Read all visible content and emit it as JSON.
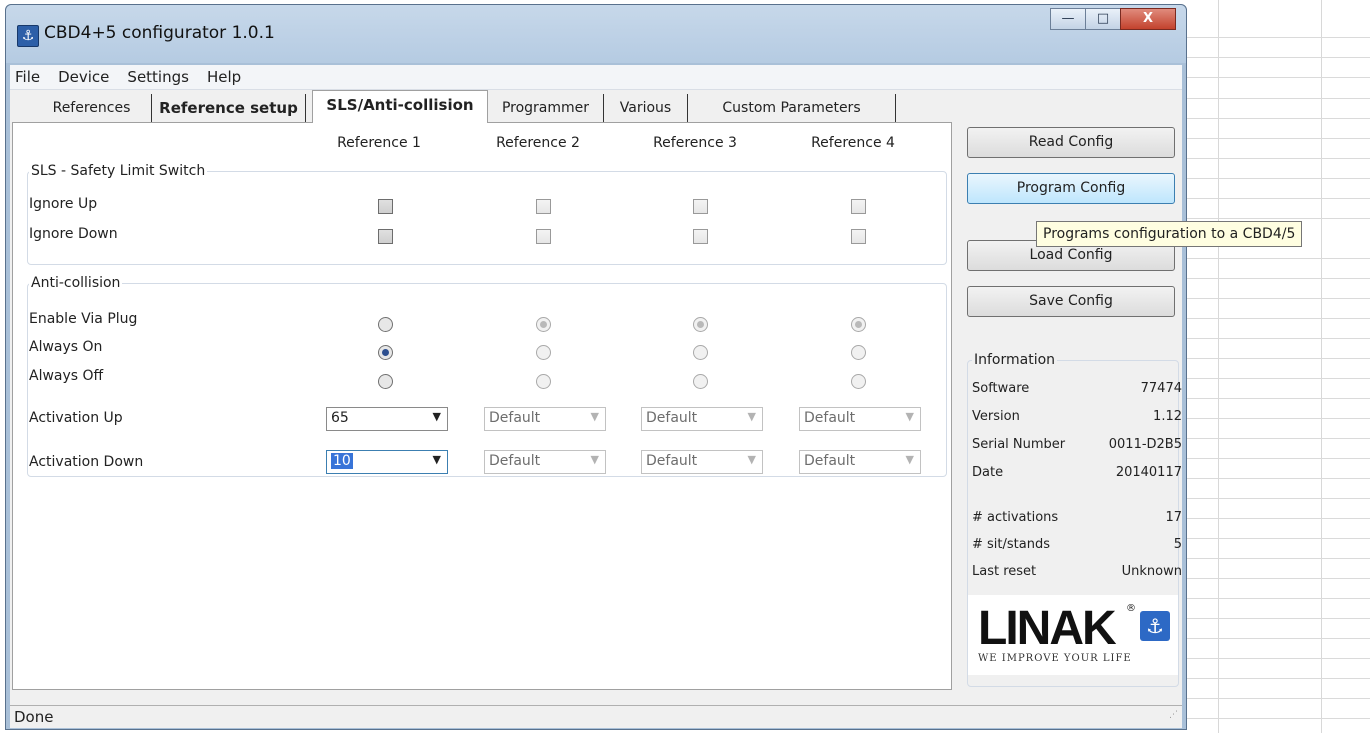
{
  "window": {
    "title": "CBD4+5 configurator 1.0.1",
    "icon": "linak-anchor-icon"
  },
  "title_buttons": {
    "minimize": "—",
    "maximize": "□",
    "close": "X"
  },
  "menu": [
    "File",
    "Device",
    "Settings",
    "Help"
  ],
  "tabs": [
    "References",
    "Reference setup",
    "SLS/Anti-collision",
    "Programmer",
    "Various",
    "Custom Parameters"
  ],
  "active_tab": "SLS/Anti-collision",
  "columns": [
    "Reference 1",
    "Reference 2",
    "Reference 3",
    "Reference 4"
  ],
  "sls": {
    "title": "SLS - Safety Limit Switch",
    "rows": [
      {
        "label": "Ignore Up",
        "checked": [
          false,
          false,
          false,
          false
        ],
        "enabled": [
          true,
          false,
          false,
          false
        ]
      },
      {
        "label": "Ignore Down",
        "checked": [
          false,
          false,
          false,
          false
        ],
        "enabled": [
          true,
          false,
          false,
          false
        ]
      }
    ]
  },
  "anti": {
    "title": "Anti-collision",
    "radio_rows": [
      "Enable Via Plug",
      "Always On",
      "Always Off"
    ],
    "selected": [
      "Always On",
      "Enable Via Plug",
      "Enable Via Plug",
      "Enable Via Plug"
    ],
    "enabled": [
      true,
      false,
      false,
      false
    ],
    "activation_up": {
      "label": "Activation Up",
      "values": [
        "65",
        "Default",
        "Default",
        "Default"
      ]
    },
    "activation_down": {
      "label": "Activation Down",
      "values": [
        "10",
        "Default",
        "Default",
        "Default"
      ]
    }
  },
  "buttons": {
    "read": "Read Config",
    "program": "Program Config",
    "load": "Load Config",
    "save": "Save Config"
  },
  "tooltip": "Programs configuration to a CBD4/5",
  "info": {
    "title": "Information",
    "rows": [
      {
        "k": "Software",
        "v": "77474"
      },
      {
        "k": "Version",
        "v": "1.12"
      },
      {
        "k": "Serial Number",
        "v": "0011-D2B5"
      },
      {
        "k": "Date",
        "v": "20140117"
      },
      {
        "k": "# activations",
        "v": "17"
      },
      {
        "k": "# sit/stands",
        "v": "5"
      },
      {
        "k": "Last reset",
        "v": "Unknown"
      }
    ]
  },
  "logo": {
    "word": "LINAK",
    "reg": "®",
    "tagline": "WE IMPROVE YOUR LIFE"
  },
  "status": "Done"
}
